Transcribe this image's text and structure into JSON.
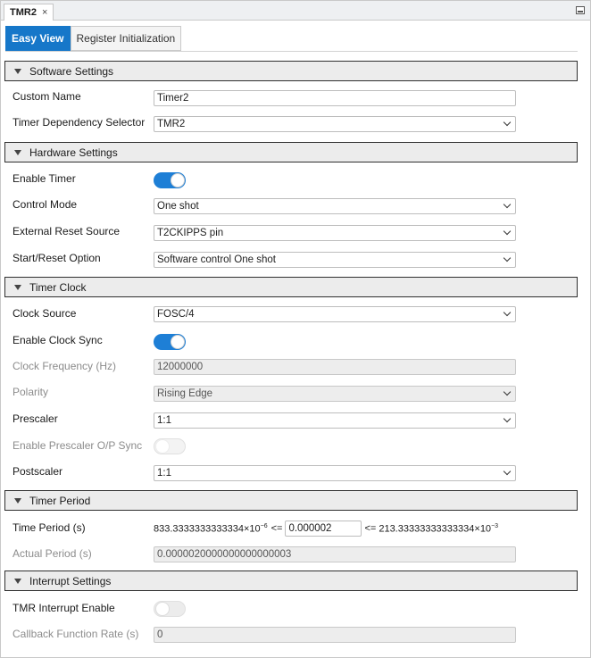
{
  "doc_tab": {
    "title": "TMR2",
    "close_glyph": "×"
  },
  "view_tabs": [
    {
      "label": "Easy View",
      "active": true
    },
    {
      "label": "Register Initialization",
      "active": false
    }
  ],
  "sections": {
    "software": "Software Settings",
    "hardware": "Hardware Settings",
    "clock": "Timer Clock",
    "period": "Timer Period",
    "interrupt": "Interrupt Settings"
  },
  "software": {
    "custom_name": {
      "label": "Custom Name",
      "value": "Timer2"
    },
    "dependency": {
      "label": "Timer Dependency Selector",
      "value": "TMR2"
    }
  },
  "hardware": {
    "enable_timer": {
      "label": "Enable Timer",
      "on": true
    },
    "control_mode": {
      "label": "Control Mode",
      "value": "One shot"
    },
    "ext_reset": {
      "label": "External Reset Source",
      "value": "T2CKIPPS pin"
    },
    "start_reset": {
      "label": "Start/Reset Option",
      "value": "Software control One shot"
    }
  },
  "clock": {
    "source": {
      "label": "Clock Source",
      "value": "FOSC/4"
    },
    "sync": {
      "label": "Enable Clock Sync",
      "on": true
    },
    "frequency": {
      "label": "Clock Frequency (Hz)",
      "value": "12000000"
    },
    "polarity": {
      "label": "Polarity",
      "value": "Rising Edge"
    },
    "prescaler": {
      "label": "Prescaler",
      "value": "1:1"
    },
    "prescaler_sync": {
      "label": "Enable Prescaler O/P Sync",
      "on": false
    },
    "postscaler": {
      "label": "Postscaler",
      "value": "1:1"
    }
  },
  "period": {
    "time_period": {
      "label": "Time Period (s)",
      "min_mantissa": "833.3333333333334",
      "min_exp": "−6",
      "le1": "<=",
      "value": "0.000002",
      "le2": "<=",
      "max_mantissa": "213.33333333333334",
      "max_exp": "−3",
      "times": "×10"
    },
    "actual_period": {
      "label": "Actual Period (s)",
      "value": "0.0000020000000000000003"
    }
  },
  "interrupt": {
    "enable": {
      "label": "TMR Interrupt Enable",
      "on": false
    },
    "callback_rate": {
      "label": "Callback Function Rate (s)",
      "value": "0"
    }
  },
  "colors": {
    "accent": "#1677c9",
    "toggle_on": "#1e7fd6",
    "section_bg": "#ececec"
  },
  "icons": {
    "section_toggle": "triangle-down-icon",
    "dropdown": "chevron-down-icon",
    "panel": "maximize-icon"
  }
}
